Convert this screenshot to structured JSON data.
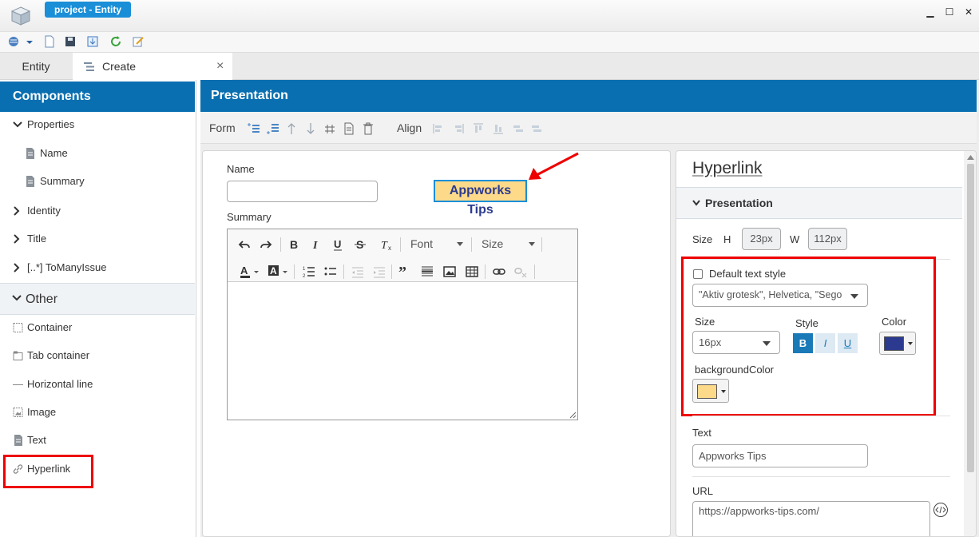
{
  "window": {
    "title": "project - Entity",
    "minimize": "▁",
    "maximize": "☐",
    "close": "✕"
  },
  "toolbar": {
    "icons": [
      "globe-dropdown-icon",
      "new-document-icon",
      "save-icon",
      "export-icon",
      "refresh-icon",
      "edit-icon"
    ]
  },
  "tabs": [
    {
      "label": "Entity"
    },
    {
      "label": "Create",
      "close": "×"
    }
  ],
  "components": {
    "title": "Components",
    "properties_label": "Properties",
    "items": [
      {
        "label": "Name"
      },
      {
        "label": "Summary"
      },
      {
        "label": "Identity"
      },
      {
        "label": "Title"
      },
      {
        "label": "[..*] ToManyIssue"
      }
    ],
    "other_label": "Other",
    "other_items": [
      {
        "label": "Container"
      },
      {
        "label": "Tab container"
      },
      {
        "label": "Horizontal line"
      },
      {
        "label": "Image"
      },
      {
        "label": "Text"
      },
      {
        "label": "Hyperlink"
      }
    ]
  },
  "presentation": {
    "title": "Presentation",
    "form_label": "Form",
    "align_label": "Align"
  },
  "canvas": {
    "name_label": "Name",
    "summary_label": "Summary",
    "hyperlink_text": "Appworks Tips",
    "rte": {
      "font": "Font",
      "size": "Size"
    }
  },
  "props": {
    "title": "Hyperlink",
    "section": "Presentation",
    "size_label": "Size",
    "h_label": "H",
    "h_value": "23px",
    "w_label": "W",
    "w_value": "112px",
    "default_style_label": "Default text style",
    "font_value": "\"Aktiv grotesk\", Helvetica, \"Sego",
    "size2_label": "Size",
    "size2_value": "16px",
    "style_label": "Style",
    "bold": "B",
    "italic": "I",
    "underline": "U",
    "color_label": "Color",
    "color_value": "#2b3a8f",
    "bg_label": "backgroundColor",
    "bg_value": "#fdd98a",
    "text_label": "Text",
    "text_value": "Appworks Tips",
    "url_label": "URL",
    "url_value": "https://appworks-tips.com/"
  },
  "colors": {
    "accent": "#0a6fb0",
    "highlight": "#e00000",
    "link_text": "#2b3a8f",
    "link_bg": "#fdd98a"
  }
}
